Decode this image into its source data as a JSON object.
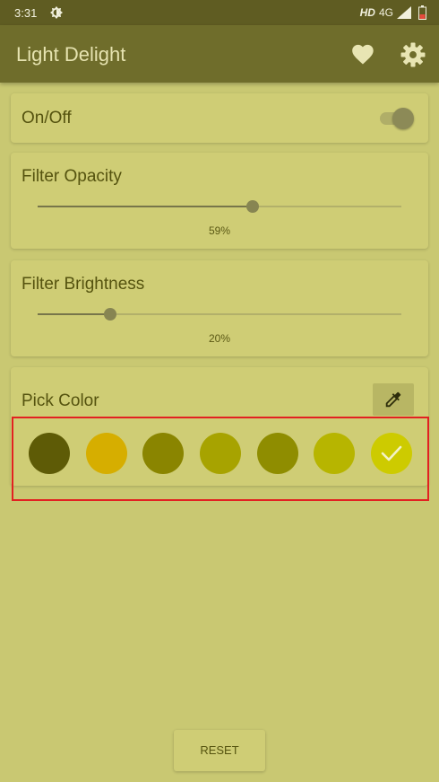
{
  "status_bar": {
    "time": "3:31",
    "hd": "HD",
    "network": "4G"
  },
  "app_bar": {
    "title": "Light Delight",
    "heart_icon": "heart-icon",
    "settings_icon": "gear-icon"
  },
  "on_off": {
    "label": "On/Off",
    "enabled": true
  },
  "opacity": {
    "label": "Filter Opacity",
    "value_text": "59%",
    "value": 59
  },
  "brightness": {
    "label": "Filter Brightness",
    "value_text": "20%",
    "value": 20
  },
  "pick_color": {
    "label": "Pick Color",
    "eyedropper_icon": "eyedropper-icon",
    "swatches": [
      {
        "color": "#5e5b06",
        "selected": false
      },
      {
        "color": "#d6ae00",
        "selected": false
      },
      {
        "color": "#8a8500",
        "selected": false
      },
      {
        "color": "#a7a300",
        "selected": false
      },
      {
        "color": "#8f8d00",
        "selected": false
      },
      {
        "color": "#b7b500",
        "selected": false
      },
      {
        "color": "#cdcb00",
        "selected": true
      }
    ]
  },
  "reset": {
    "label": "RESET"
  },
  "colors": {
    "background": "#c9c872",
    "app_bar": "#6f6d2b",
    "status_bar": "#5f5c22",
    "card": "#cfcd75",
    "highlight": "#e22121"
  }
}
